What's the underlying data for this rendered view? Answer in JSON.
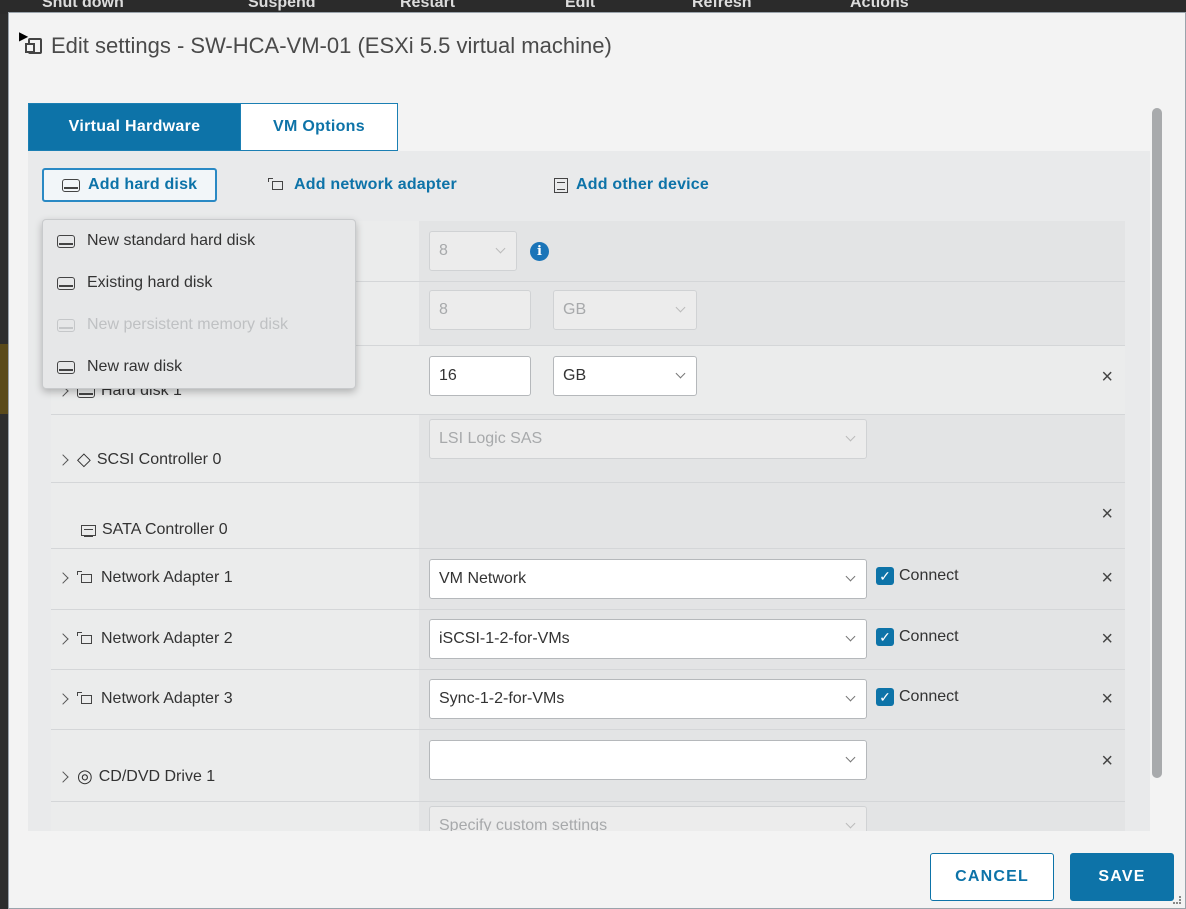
{
  "background_toolbar": {
    "items": [
      "Shut down",
      "Suspend",
      "Restart",
      "Edit",
      "Refresh",
      "Actions"
    ]
  },
  "dialog": {
    "title": "Edit settings - SW-HCA-VM-01 (ESXi 5.5 virtual machine)",
    "tabs": [
      {
        "label": "Virtual Hardware",
        "active": true
      },
      {
        "label": "VM Options",
        "active": false
      }
    ],
    "actions": {
      "add_hard_disk": "Add hard disk",
      "add_network_adapter": "Add network adapter",
      "add_other_device": "Add other device"
    },
    "add_disk_menu": [
      {
        "label": "New standard hard disk",
        "enabled": true
      },
      {
        "label": "Existing hard disk",
        "enabled": true
      },
      {
        "label": "New persistent memory disk",
        "enabled": false
      },
      {
        "label": "New raw disk",
        "enabled": true
      }
    ],
    "hardware": {
      "cpu": {
        "value": "8"
      },
      "memory": {
        "value": "8",
        "unit": "GB"
      },
      "hard_disk_1": {
        "label": "Hard disk 1",
        "size": "16",
        "unit": "GB"
      },
      "scsi_controller": {
        "label": "SCSI Controller 0",
        "value": "LSI Logic SAS"
      },
      "sata_controller": {
        "label": "SATA Controller 0"
      },
      "network_adapters": [
        {
          "label": "Network Adapter 1",
          "network": "VM Network",
          "connect_label": "Connect",
          "connected": true
        },
        {
          "label": "Network Adapter 2",
          "network": "iSCSI-1-2-for-VMs",
          "connect_label": "Connect",
          "connected": true
        },
        {
          "label": "Network Adapter 3",
          "network": "Sync-1-2-for-VMs",
          "connect_label": "Connect",
          "connected": true
        }
      ],
      "cd_dvd": {
        "label": "CD/DVD Drive 1",
        "value": ""
      },
      "video_card": {
        "value": "Specify custom settings"
      }
    },
    "remove_symbol": "×",
    "buttons": {
      "cancel": "CANCEL",
      "save": "SAVE"
    }
  },
  "colors": {
    "accent": "#0d73a8",
    "panel": "#e9eaeb",
    "dialog_bg": "#f3f3f3"
  }
}
